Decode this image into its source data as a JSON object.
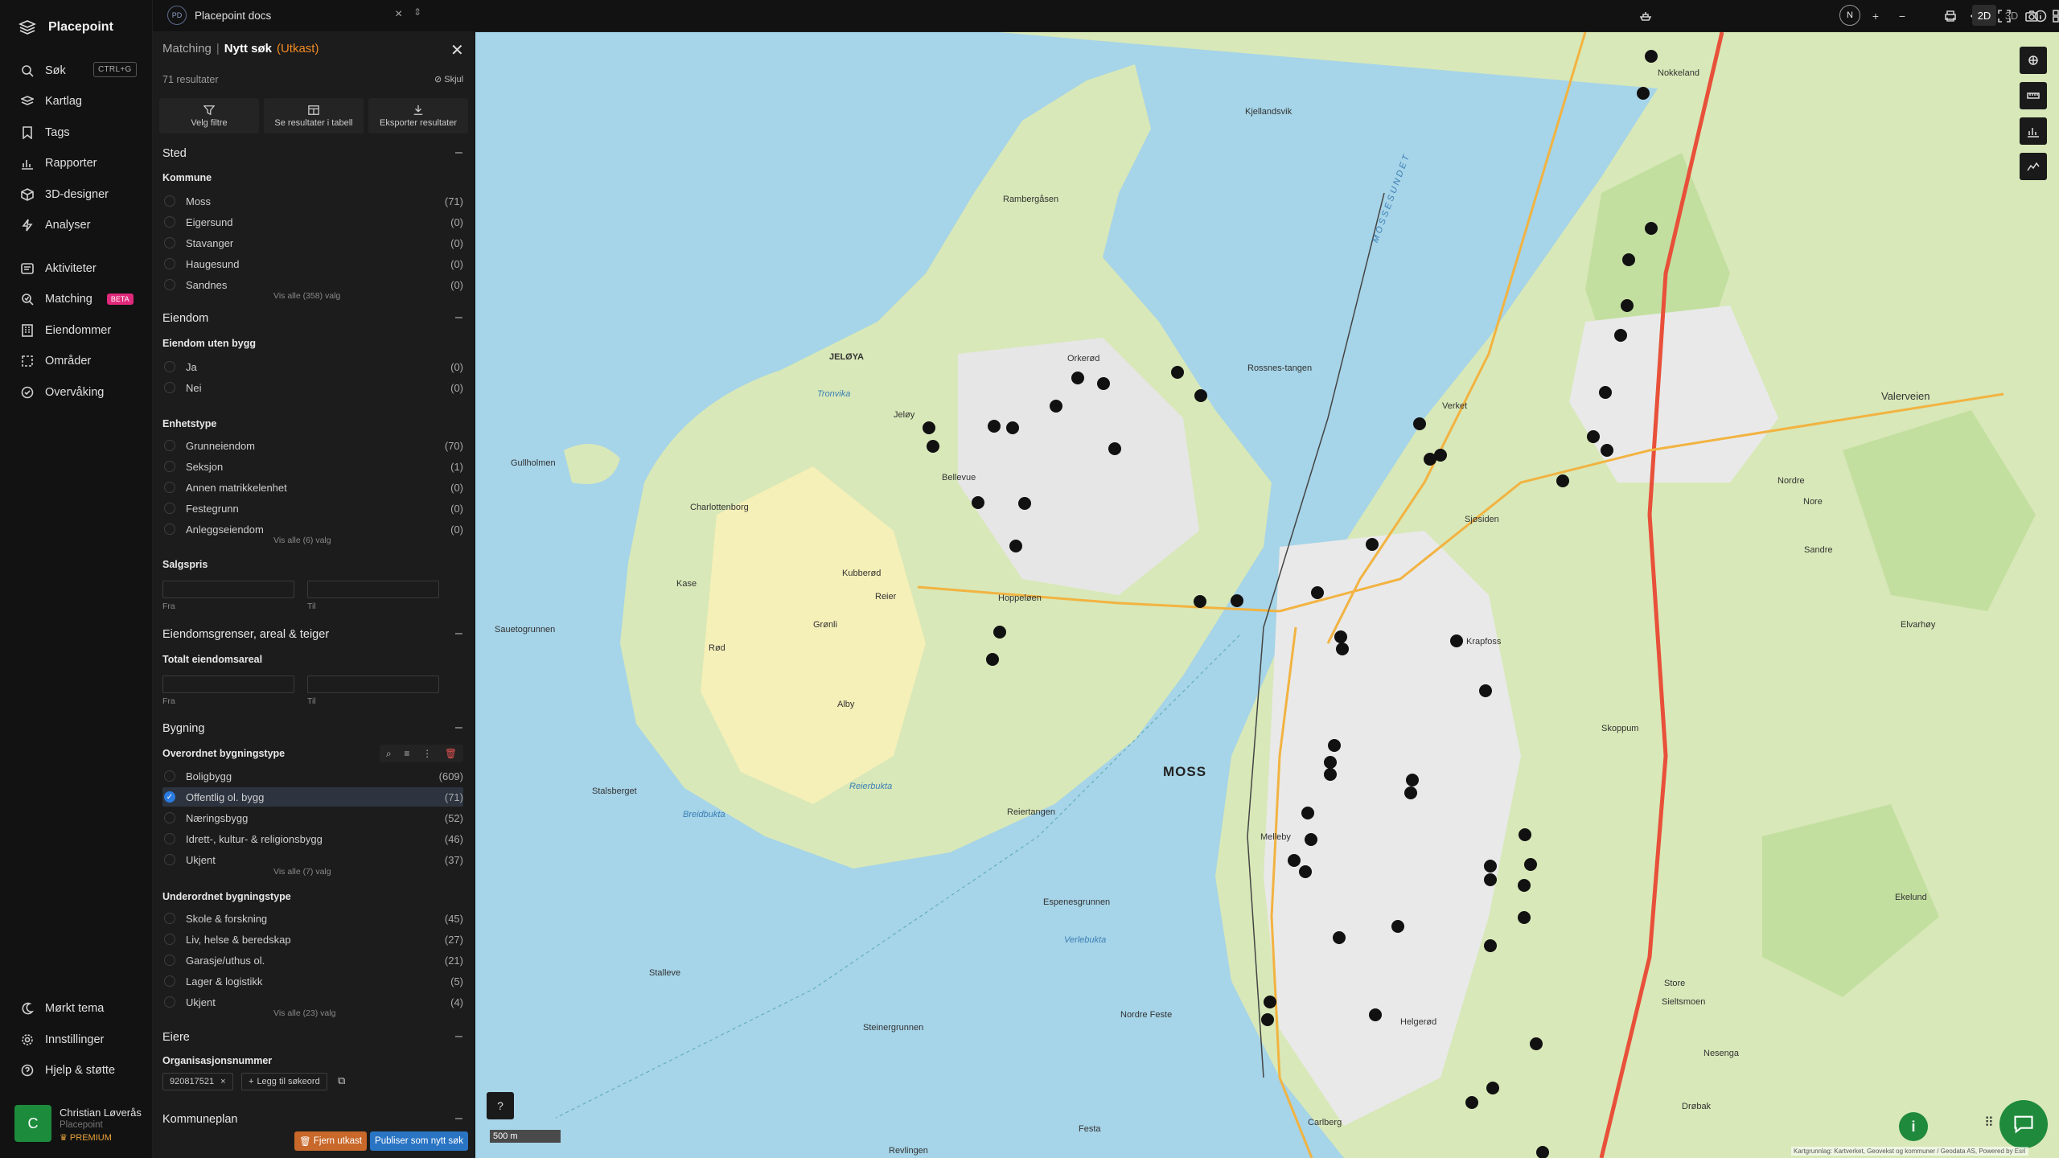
{
  "app": {
    "name": "Placepoint"
  },
  "nav": {
    "search": "Søk",
    "search_kbd": "CTRL+G",
    "items": [
      "Kartlag",
      "Tags",
      "Rapporter",
      "3D-designer",
      "Analyser",
      "Aktiviteter",
      "Matching",
      "Eiendommer",
      "Områder",
      "Overvåking"
    ],
    "beta": "BETA",
    "bottom": [
      "Mørkt tema",
      "Innstillinger",
      "Hjelp & støtte"
    ],
    "user": {
      "initial": "C",
      "name": "Christian Løverås",
      "org": "Placepoint",
      "plan": "PREMIUM"
    }
  },
  "topbar": {
    "doc_badge": "PD",
    "doc_title": "Placepoint docs",
    "compass": "N",
    "view_2d": "2D",
    "view_3d": "3D"
  },
  "panel": {
    "crumb": "Matching",
    "title": "Nytt søk",
    "status": "(Utkast)",
    "results": "71 resultater",
    "hide": "Skjul",
    "actions": [
      "Velg filtre",
      "Se resultater i tabell",
      "Eksporter resultater"
    ],
    "sted": {
      "title": "Sted",
      "sub": "Kommune",
      "rows": [
        {
          "label": "Moss",
          "count": "(71)"
        },
        {
          "label": "Eigersund",
          "count": "(0)"
        },
        {
          "label": "Stavanger",
          "count": "(0)"
        },
        {
          "label": "Haugesund",
          "count": "(0)"
        },
        {
          "label": "Sandnes",
          "count": "(0)"
        }
      ],
      "more": "Vis alle (358) valg"
    },
    "eiendom": {
      "title": "Eiendom",
      "sub1": "Eiendom uten bygg",
      "rows1": [
        {
          "label": "Ja",
          "count": "(0)"
        },
        {
          "label": "Nei",
          "count": "(0)"
        }
      ],
      "sub2": "Enhetstype",
      "rows2": [
        {
          "label": "Grunneiendom",
          "count": "(70)"
        },
        {
          "label": "Seksjon",
          "count": "(1)"
        },
        {
          "label": "Annen matrikkelenhet",
          "count": "(0)"
        },
        {
          "label": "Festegrunn",
          "count": "(0)"
        },
        {
          "label": "Anleggseiendom",
          "count": "(0)"
        }
      ],
      "more": "Vis alle (6) valg",
      "sub3": "Salgspris",
      "from": "Fra",
      "to": "Til"
    },
    "areal": {
      "title": "Eiendomsgrenser, areal & teiger",
      "sub": "Totalt eiendomsareal",
      "from": "Fra",
      "to": "Til"
    },
    "bygning": {
      "title": "Bygning",
      "sub1": "Overordnet bygningstype",
      "rows1": [
        {
          "label": "Boligbygg",
          "count": "(609)"
        },
        {
          "label": "Offentlig ol. bygg",
          "count": "(71)"
        },
        {
          "label": "Næringsbygg",
          "count": "(52)"
        },
        {
          "label": "Idrett-, kultur- & religionsbygg",
          "count": "(46)"
        },
        {
          "label": "Ukjent",
          "count": "(37)"
        }
      ],
      "more1": "Vis alle (7) valg",
      "sub2": "Underordnet bygningstype",
      "rows2": [
        {
          "label": "Skole & forskning",
          "count": "(45)"
        },
        {
          "label": "Liv, helse & beredskap",
          "count": "(27)"
        },
        {
          "label": "Garasje/uthus ol.",
          "count": "(21)"
        },
        {
          "label": "Lager & logistikk",
          "count": "(5)"
        },
        {
          "label": "Ukjent",
          "count": "(4)"
        }
      ],
      "more2": "Vis alle (23) valg"
    },
    "eiere": {
      "title": "Eiere",
      "sub": "Organisasjonsnummer",
      "chip": "920817521",
      "add": "Legg til søkeord"
    },
    "kommuneplan": "Kommuneplan",
    "remove_draft": "Fjern utkast",
    "publish": "Publiser som nytt søk"
  },
  "map": {
    "labels": [
      "MOSS",
      "JELØYA",
      "MOSSESUNDET",
      "Reierbukta",
      "Breidbukta",
      "Verlebukta",
      "Tronvika",
      "Kubberød",
      "Grønli",
      "Reier",
      "Hoppeløen",
      "Alby",
      "Kase",
      "Rød",
      "Charlottenborg",
      "Bellevue",
      "Rossnes-tangen",
      "Kjellandsvik",
      "Rambergåsen",
      "Orkerød",
      "Stalsberget",
      "Sauetogrunnen",
      "Gullholmen",
      "Espenesgrunnen",
      "Reiertangen",
      "Stalleve",
      "Steinergrunnen",
      "Melleby",
      "Helgerød",
      "Krapfoss",
      "Verket",
      "Valerveien",
      "Nore",
      "Nordre",
      "Sandre",
      "Elvarhøy",
      "Ekelund",
      "Store",
      "Sieltsmoen",
      "Nesenga",
      "Drøbak",
      "Revlingen",
      "Carlberg",
      "Festa",
      "Nordre Feste",
      "Nokkeland",
      "Jeløy",
      "Sjøsiden",
      "Skoppum"
    ],
    "scale": "500 m",
    "attribution": "Kartgrunnlag: Kartverket, Geovekst og kommuner / Geodata AS, Powered by Esri"
  }
}
